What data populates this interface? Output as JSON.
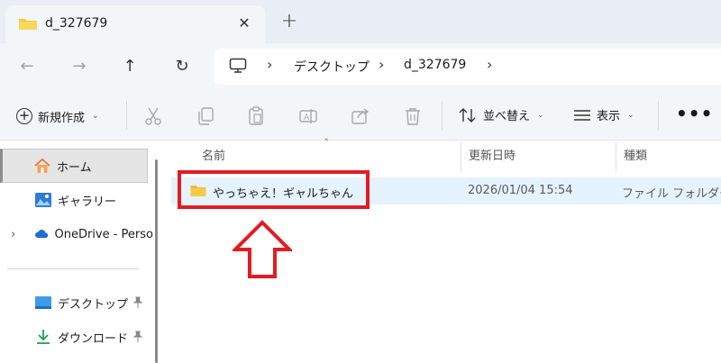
{
  "tab": {
    "title": "d_327679",
    "close": "✕",
    "new": "+"
  },
  "nav": {
    "back": "←",
    "forward": "→",
    "up": "↑",
    "refresh": "↻",
    "crumbs": [
      "デスクトップ",
      "d_327679"
    ],
    "chevron": "›"
  },
  "toolbar": {
    "new_label": "新規作成",
    "sort_label": "並べ替え",
    "view_label": "表示",
    "more": "•••",
    "caret": "⌄"
  },
  "sidebar": {
    "items": [
      {
        "label": "ホーム",
        "icon": "home-icon",
        "active": true
      },
      {
        "label": "ギャラリー",
        "icon": "gallery-icon"
      },
      {
        "label": "OneDrive - Perso",
        "icon": "cloud-icon",
        "expander": "›"
      }
    ],
    "pinned": [
      {
        "label": "デスクトップ",
        "icon": "desktop-icon"
      },
      {
        "label": "ダウンロード",
        "icon": "download-icon"
      }
    ]
  },
  "columns": {
    "name": "名前",
    "date": "更新日時",
    "type": "種類"
  },
  "rows": [
    {
      "name": "やっちゃえ！ギャルちゃん",
      "date": "2026/01/04 15:54",
      "type": "ファイル フォルダー"
    }
  ],
  "colors": {
    "highlight": "#e31b23",
    "folder": "#f7c948",
    "selection": "#e5f3ff"
  }
}
